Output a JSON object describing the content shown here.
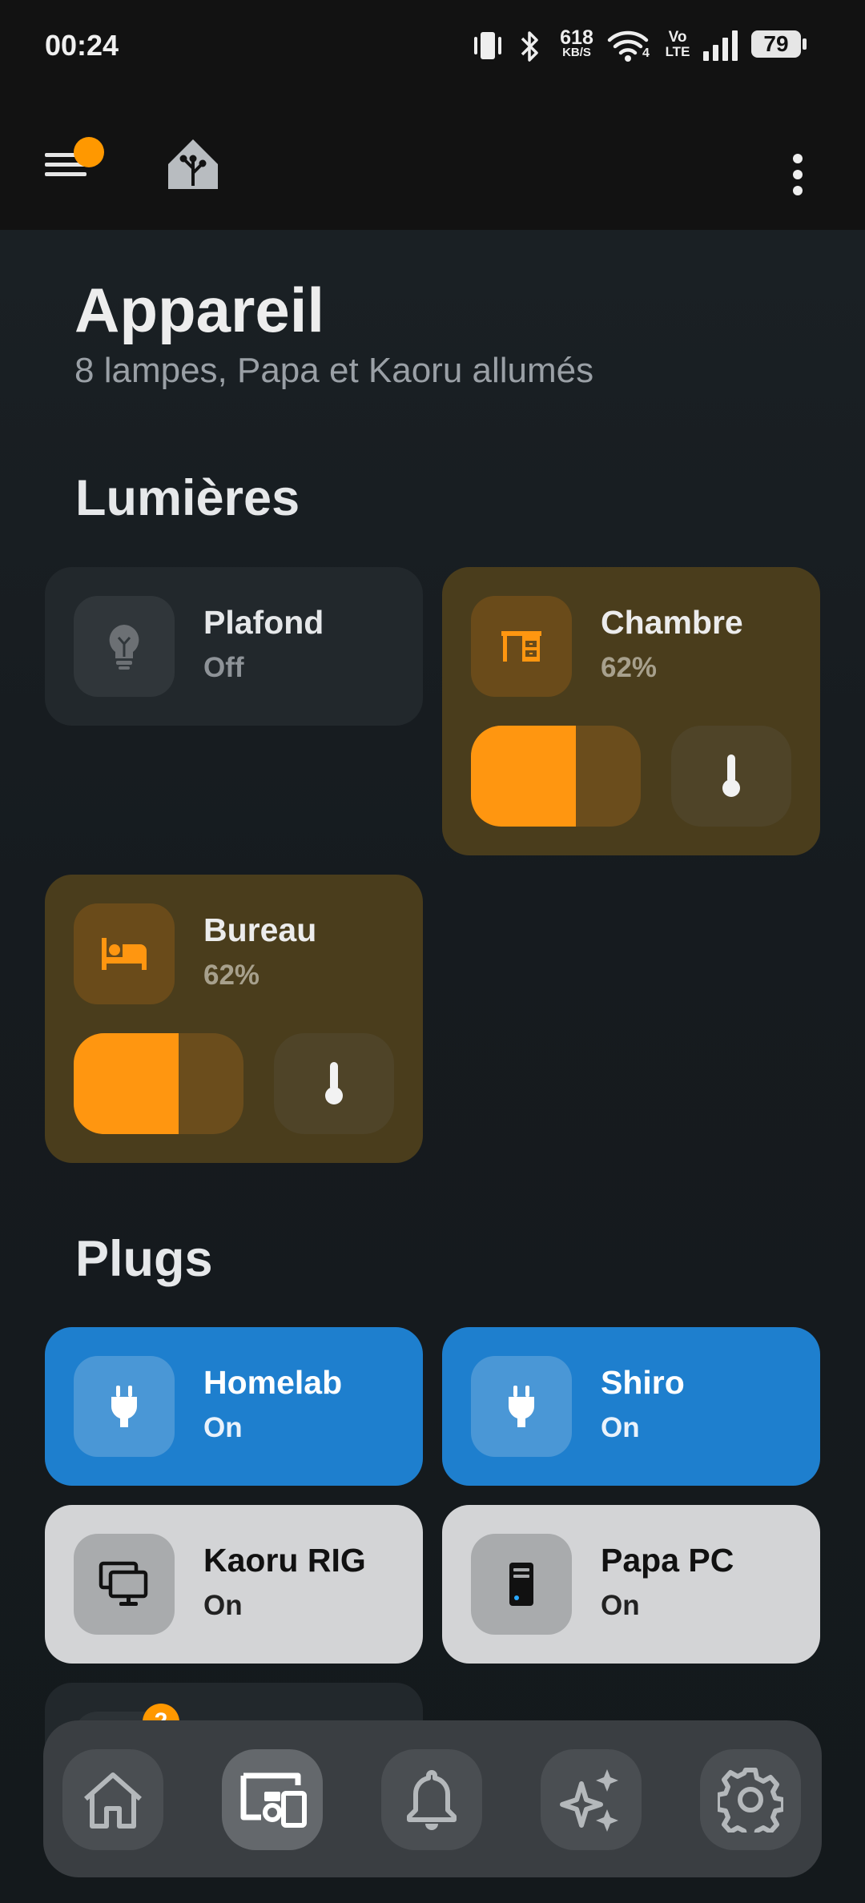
{
  "status_bar": {
    "time": "00:24",
    "net_speed_value": "618",
    "net_speed_unit": "KB/S",
    "volte_top": "Vo",
    "volte_bottom": "LTE",
    "wifi_label": "4",
    "battery": "79",
    "icons": [
      "vibrate-icon",
      "bluetooth-icon",
      "wifi-icon",
      "signal-icon",
      "battery-icon"
    ]
  },
  "header": {
    "icons": [
      "menu-icon",
      "home-assistant-logo",
      "more-vert-icon"
    ],
    "notification_dot_color": "#ff9800"
  },
  "page": {
    "title": "Appareil",
    "subtitle": "8 lampes, Papa et Kaoru allumés"
  },
  "sections": {
    "lights_title": "Lumières",
    "plugs_title": "Plugs"
  },
  "lights": [
    {
      "name": "Plafond",
      "state": "Off",
      "icon": "lightbulb-icon"
    },
    {
      "name": "Chambre",
      "state": "62%",
      "icon": "desk-icon",
      "brightness": 0.62
    },
    {
      "name": "Bureau",
      "state": "62%",
      "icon": "bed-icon",
      "brightness": 0.62
    }
  ],
  "plugs": [
    {
      "name": "Homelab",
      "state": "On",
      "icon": "power-plug-icon"
    },
    {
      "name": "Shiro",
      "state": "On",
      "icon": "power-plug-icon"
    },
    {
      "name": "Kaoru RIG",
      "state": "On",
      "icon": "monitor-icon"
    },
    {
      "name": "Papa PC",
      "state": "On",
      "icon": "desktop-tower-icon"
    }
  ],
  "partial_card_badge": "2",
  "bottom_nav": [
    {
      "name": "home-icon",
      "active": false
    },
    {
      "name": "devices-icon",
      "active": true
    },
    {
      "name": "bell-icon",
      "active": false
    },
    {
      "name": "sparkles-icon",
      "active": false
    },
    {
      "name": "settings-icon",
      "active": false
    }
  ],
  "colors": {
    "accent_orange": "#ff9610",
    "plug_blue": "#1e7fce",
    "light_card_amber": "#4a3d1c"
  }
}
